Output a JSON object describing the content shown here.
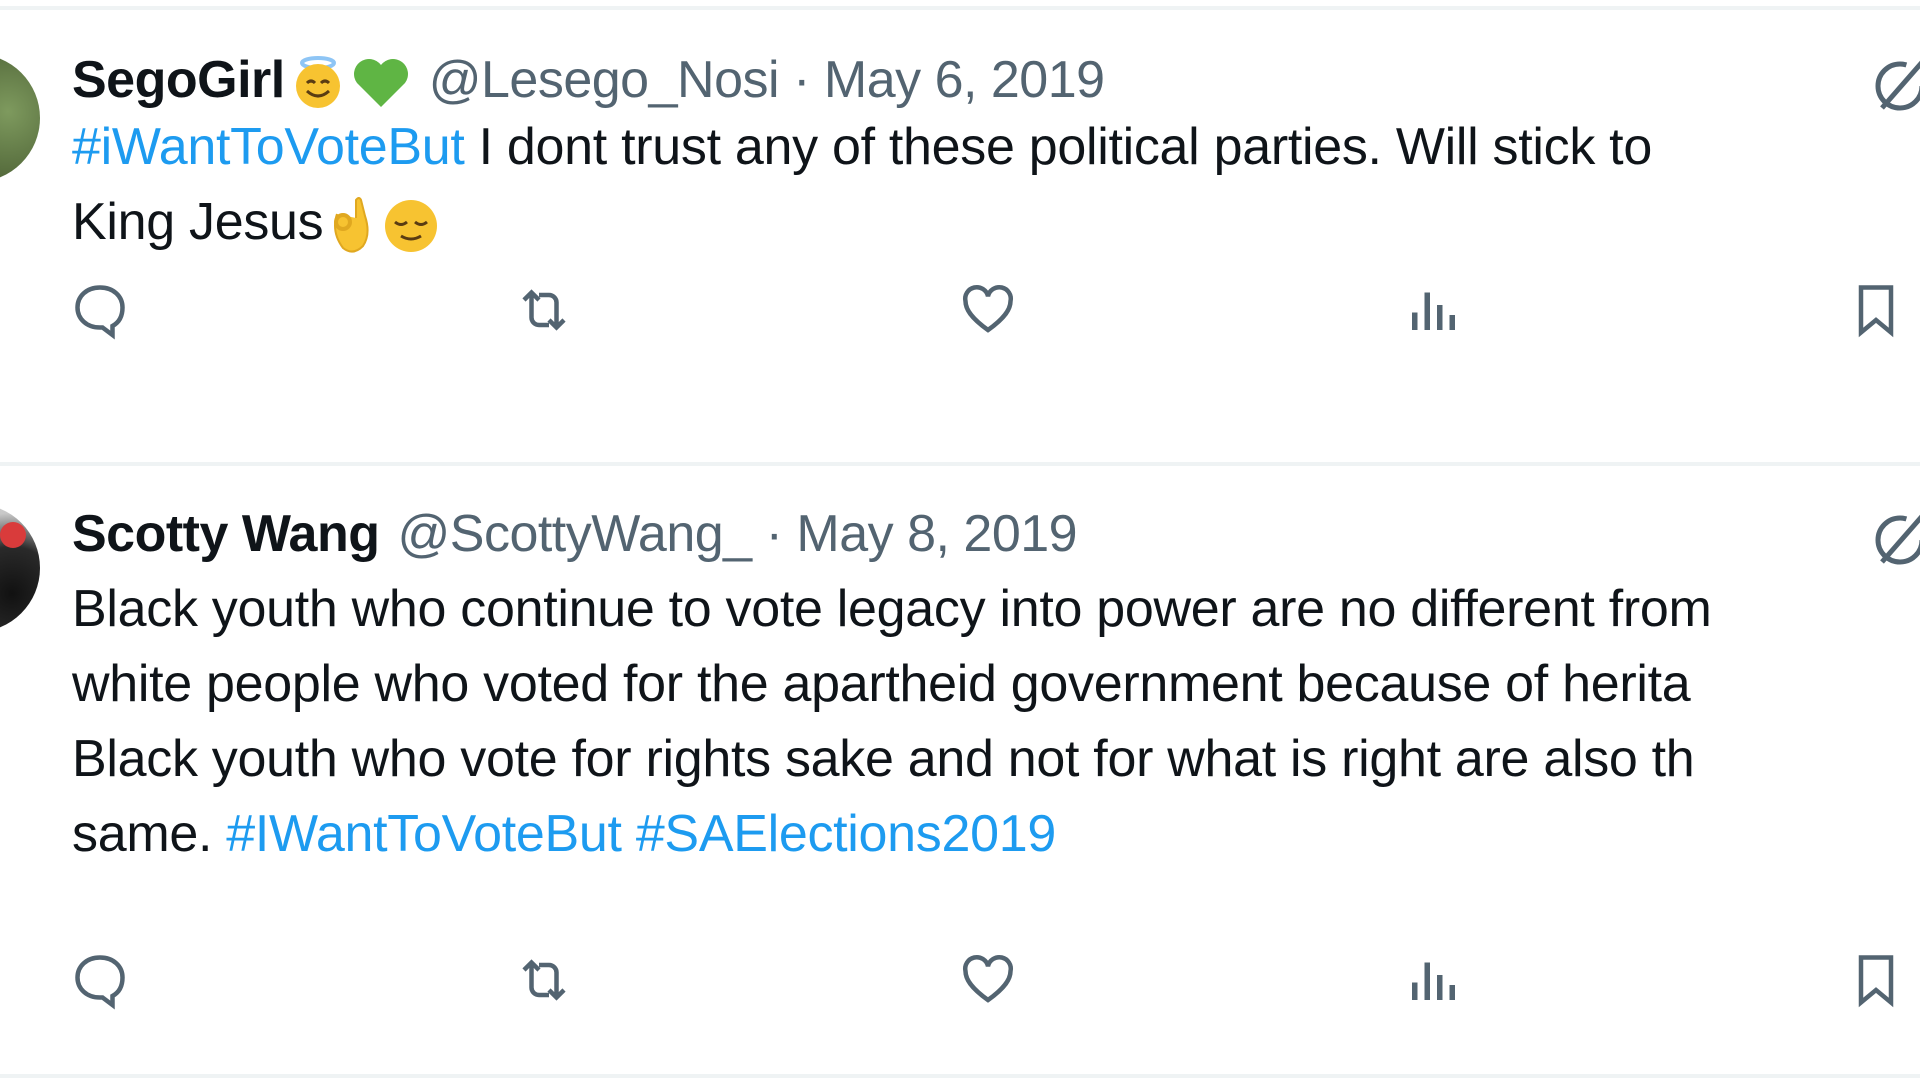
{
  "tweets": [
    {
      "display_name": "SegoGirl",
      "name_emojis": [
        "angel-face-emoji",
        "green-heart-emoji"
      ],
      "handle": "@Lesego_Nosi",
      "separator": "·",
      "date": "May 6, 2019",
      "text_lines": [
        {
          "hashtag": "#iWantToVoteBut",
          "text": " I dont trust any of these political parties. Will stick to"
        },
        {
          "text": "King Jesus"
        }
      ],
      "trailing_emojis": [
        "ok-hand-emoji",
        "relieved-face-emoji"
      ]
    },
    {
      "display_name": "Scotty Wang",
      "handle": "@ScottyWang_",
      "separator": "·",
      "date": "May 8, 2019",
      "text_lines": [
        {
          "text": "Black youth who continue to vote legacy into power are no different from"
        },
        {
          "text": "white people who voted for the apartheid government because of herita"
        },
        {
          "text": "Black youth who vote for rights sake and not for what is right are also th"
        },
        {
          "text": "same. ",
          "hashtag1": "#IWantToVoteBut",
          "hashtag2": "#SAElections2019"
        }
      ]
    }
  ],
  "colors": {
    "text": "#0f1419",
    "secondary": "#536471",
    "hashtag": "#1d9bf0",
    "divider": "#eff3f4"
  }
}
